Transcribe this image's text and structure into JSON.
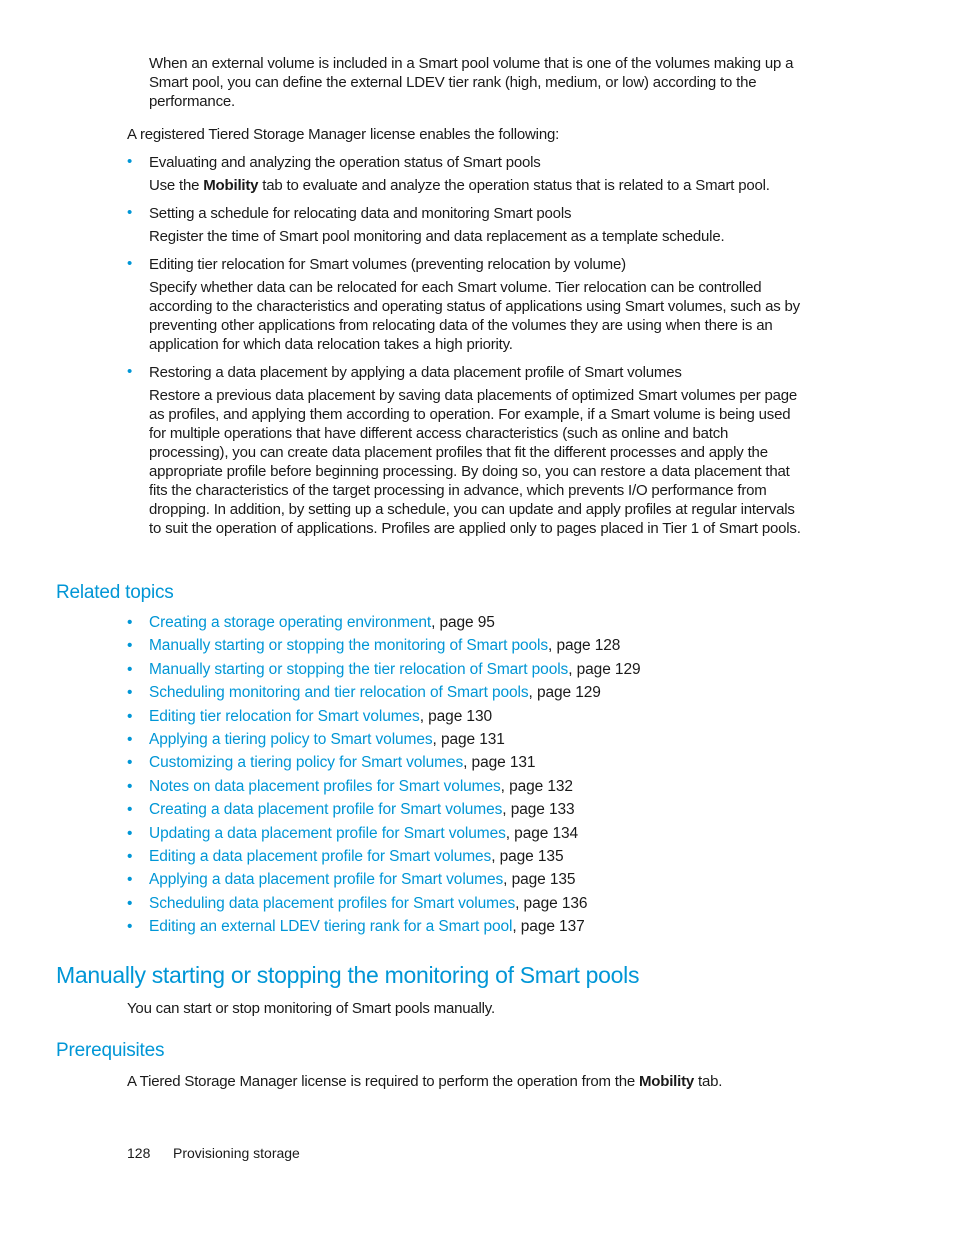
{
  "intro": {
    "note_paragraph": "When an external volume is included in a Smart pool volume that is one of the volumes making up a Smart pool, you can define the external LDEV tier rank (high, medium, or low) according to the performance.",
    "license_intro": "A registered Tiered Storage Manager license enables the following:"
  },
  "features": [
    {
      "title": "Evaluating and analyzing the operation status of Smart pools",
      "desc_prefix": "Use the ",
      "desc_bold": "Mobility",
      "desc_suffix": " tab to evaluate and analyze the operation status that is related to a Smart pool."
    },
    {
      "title": "Setting a schedule for relocating data and monitoring Smart pools",
      "desc": "Register the time of Smart pool monitoring and data replacement as a template schedule."
    },
    {
      "title": "Editing tier relocation for Smart volumes (preventing relocation by volume)",
      "desc": "Specify whether data can be relocated for each Smart volume. Tier relocation can be controlled according to the characteristics and operating status of applications using Smart volumes, such as by preventing other applications from relocating data of the volumes they are using when there is an application for which data relocation takes a high priority."
    },
    {
      "title": "Restoring a data placement by applying a data placement profile of Smart volumes",
      "desc": "Restore a previous data placement by saving data placements of optimized Smart volumes per page as profiles, and applying them according to operation. For example, if a Smart volume is being used for multiple operations that have different access characteristics (such as online and batch processing), you can create data placement profiles that fit the different processes and apply the appropriate profile before beginning processing. By doing so, you can restore a data placement that fits the characteristics of the target processing in advance, which prevents I/O performance from dropping. In addition, by setting up a schedule, you can update and apply profiles at regular intervals to suit the operation of applications. Profiles are applied only to pages placed in Tier 1 of Smart pools."
    }
  ],
  "related": {
    "heading": "Related topics",
    "items": [
      {
        "link": "Creating a storage operating environment",
        "page": ", page 95"
      },
      {
        "link": "Manually starting or stopping the monitoring of Smart pools",
        "page": ", page 128"
      },
      {
        "link": "Manually starting or stopping the tier relocation of Smart pools",
        "page": ", page 129"
      },
      {
        "link": "Scheduling monitoring and tier relocation of Smart pools",
        "page": ", page 129"
      },
      {
        "link": "Editing tier relocation for Smart volumes",
        "page": ", page 130"
      },
      {
        "link": "Applying a tiering policy to Smart volumes",
        "page": ", page 131"
      },
      {
        "link": "Customizing a tiering policy for Smart volumes",
        "page": ", page 131"
      },
      {
        "link": "Notes on data placement profiles for Smart volumes",
        "page": ", page 132"
      },
      {
        "link": "Creating a data placement profile for Smart volumes",
        "page": ", page 133"
      },
      {
        "link": "Updating a data placement profile for Smart volumes",
        "page": ", page 134"
      },
      {
        "link": "Editing a data placement profile for Smart volumes",
        "page": ", page 135"
      },
      {
        "link": "Applying a data placement profile for Smart volumes",
        "page": ", page 135"
      },
      {
        "link": "Scheduling data placement profiles for Smart volumes",
        "page": ", page 136"
      },
      {
        "link": "Editing an external LDEV tiering rank for a Smart pool",
        "page": ", page 137"
      }
    ]
  },
  "section": {
    "title": "Manually starting or stopping the monitoring of Smart pools",
    "intro": "You can start or stop monitoring of Smart pools manually.",
    "prereq_heading": "Prerequisites",
    "prereq_prefix": "A Tiered Storage Manager license is required to perform the operation from the ",
    "prereq_bold": "Mobility",
    "prereq_suffix": " tab."
  },
  "footer": {
    "page_number": "128",
    "chapter": "Provisioning storage"
  },
  "colors": {
    "accent": "#0096d6",
    "text": "#1a1a1a"
  }
}
